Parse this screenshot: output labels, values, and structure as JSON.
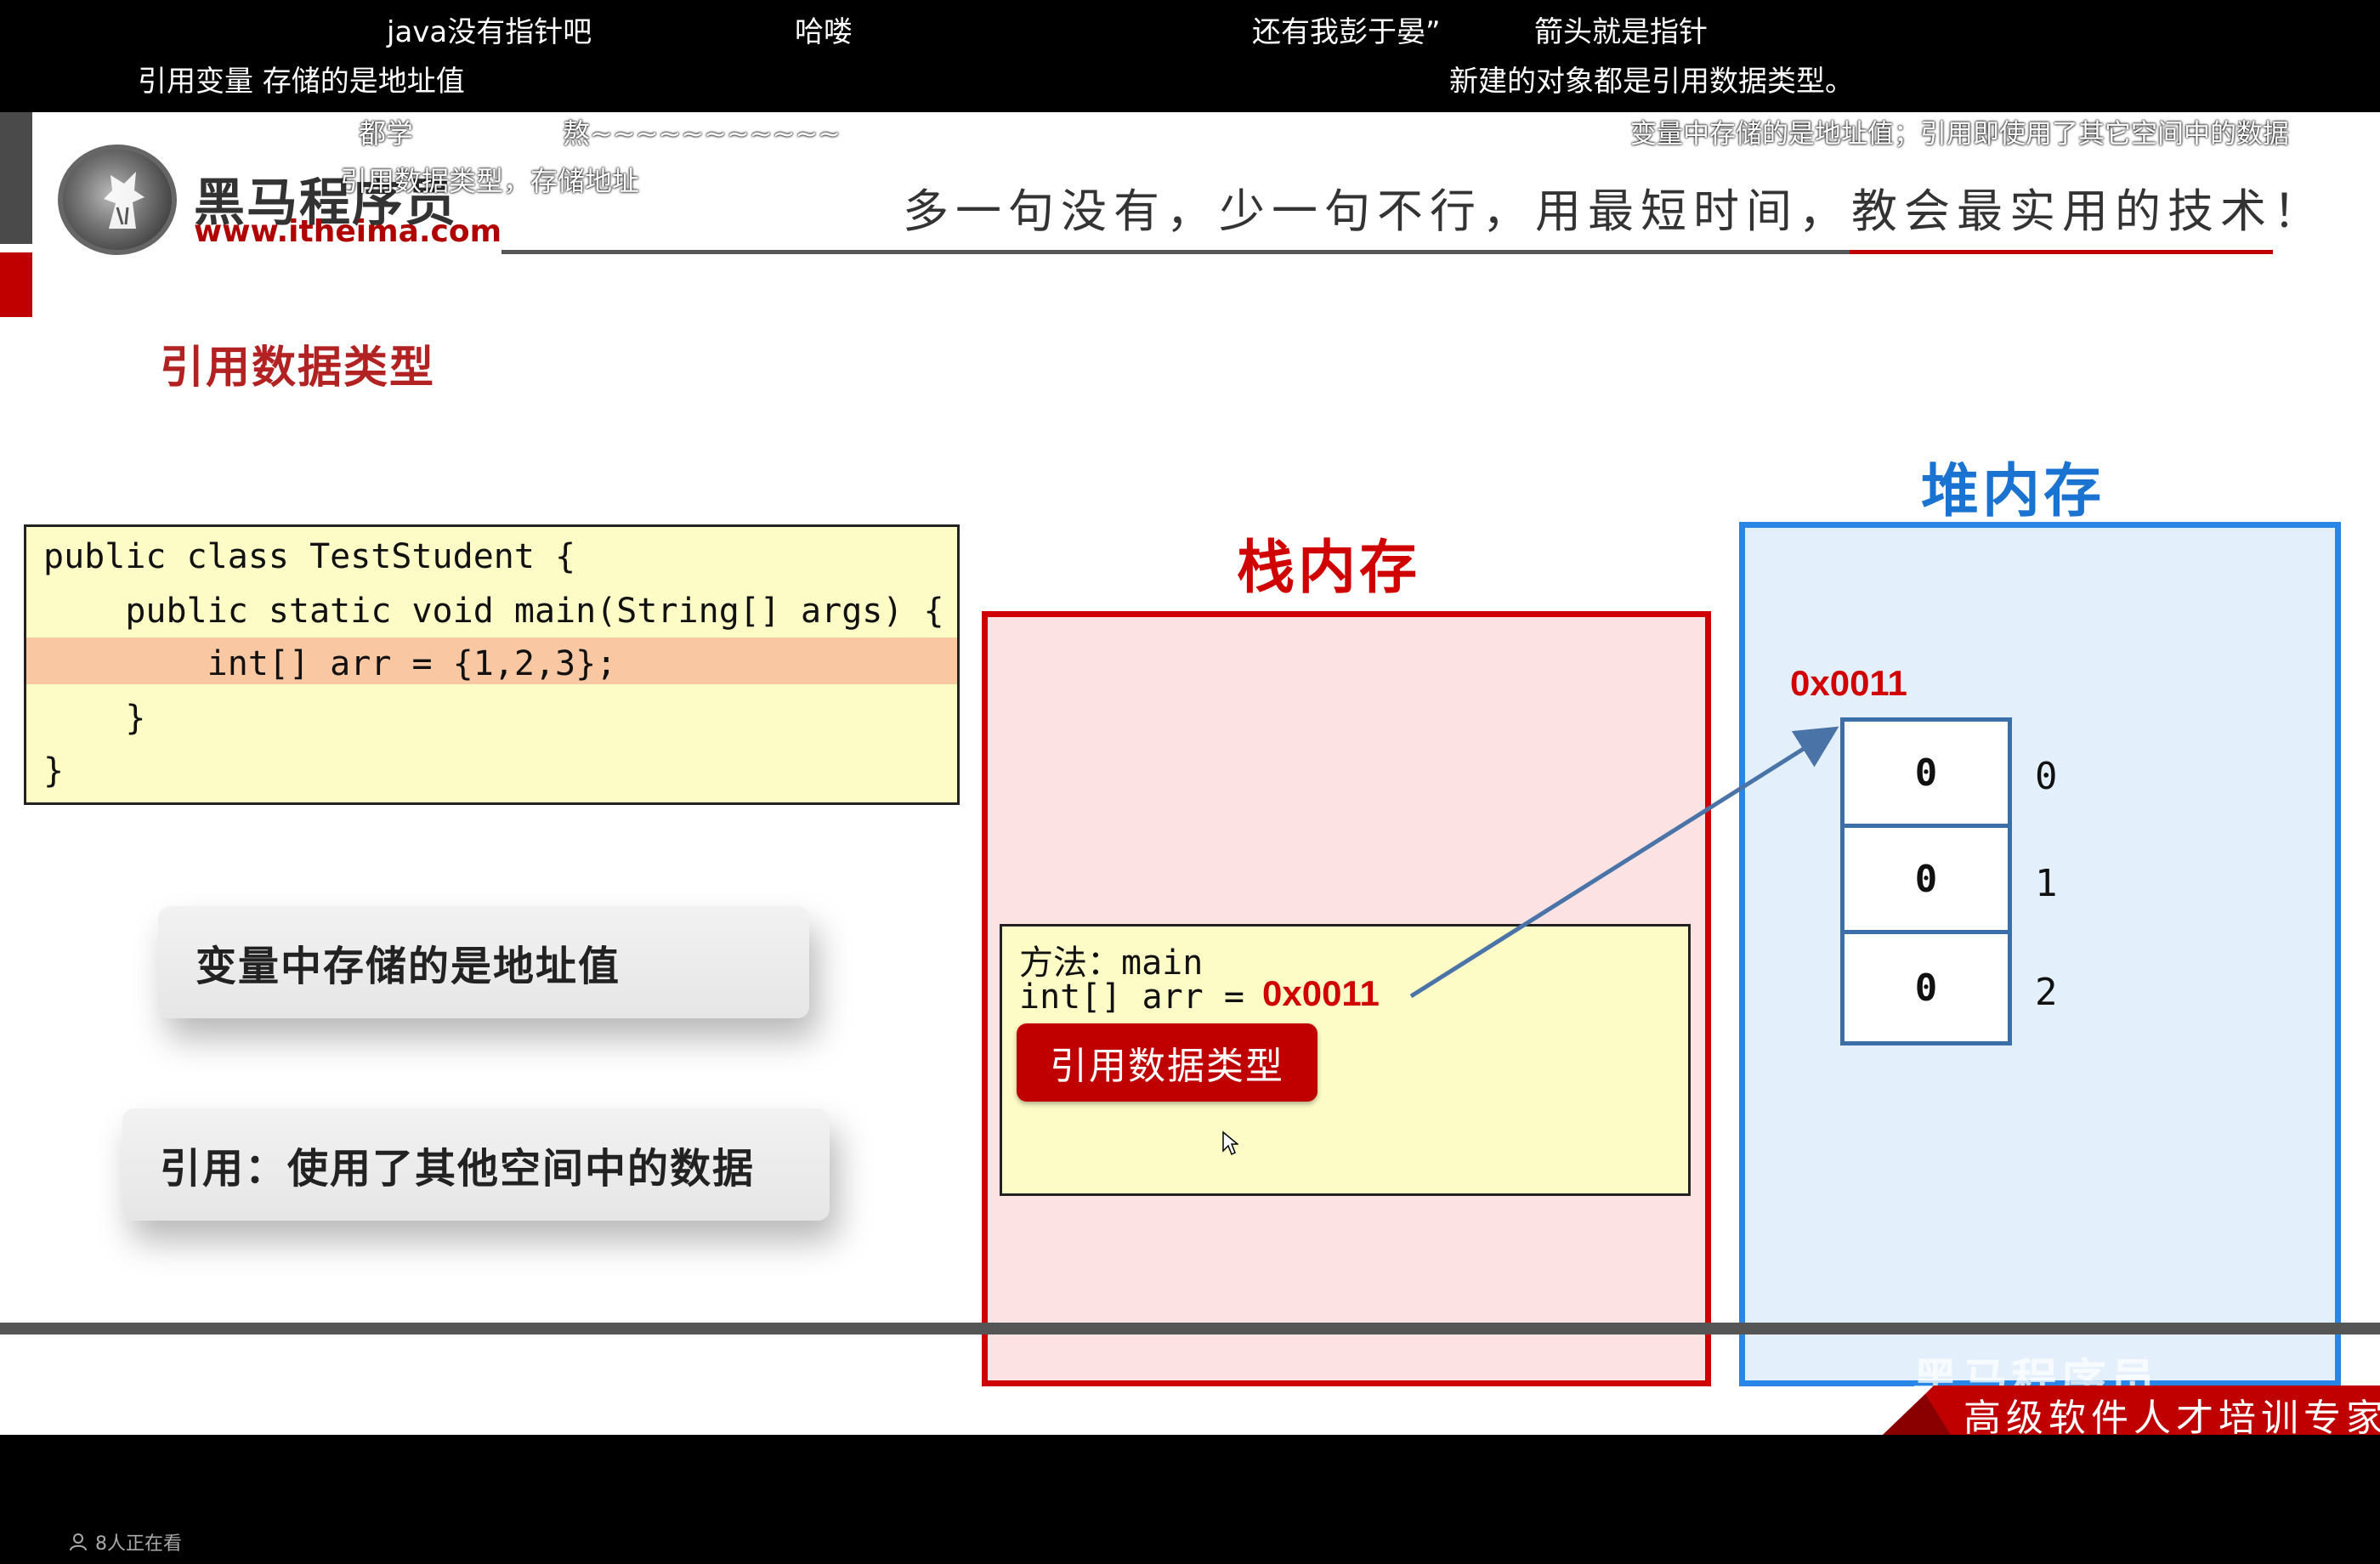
{
  "danmaku": {
    "row1": [
      "java没有指针吧",
      "哈喽",
      "还有我彭于晏”",
      "箭头就是指针"
    ],
    "row2": [
      "引用变量 存储的是地址值",
      "新建的对象都是引用数据类型。"
    ],
    "overlay": [
      "都学",
      "熬~~~~~~~~~~~",
      "变量中存储的是地址值；引用即使用了其它空间中的数据",
      "引用数据类型，存储地址"
    ]
  },
  "brand": {
    "name": "黑马程序员",
    "url": "www.itheima.com",
    "slogan": "多一句没有，少一句不行，用最短时间，教会最实用的技术！"
  },
  "section_title": "引用数据类型",
  "code": [
    "public class TestStudent {",
    "    public static void main(String[] args) {",
    "        int[] arr = {1,2,3};",
    "    }",
    "}"
  ],
  "callouts": {
    "first": "变量中存储的是地址值",
    "second": "引用：使用了其他空间中的数据"
  },
  "stack": {
    "title": "栈内存",
    "frame_method": "方法：main",
    "frame_var": "int[] arr = ",
    "address": "0x0011",
    "tag": "引用数据类型"
  },
  "heap": {
    "title": "堆内存",
    "address": "0x0011",
    "cells": [
      "0",
      "0",
      "0"
    ],
    "indices": [
      "0",
      "1",
      "2"
    ]
  },
  "footer": {
    "badge": "高级软件人才培训专家",
    "watermark": "黑马程序员",
    "viewers": "8人正在看"
  },
  "colors": {
    "stack_red": "#d00000",
    "heap_blue": "#2a86e6",
    "code_bg": "#fdfcc6",
    "highlight": "#f9c8a2"
  }
}
